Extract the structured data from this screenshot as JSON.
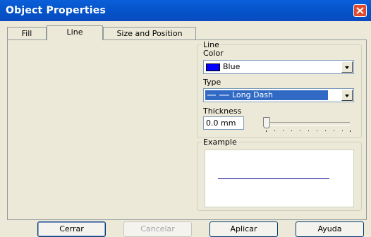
{
  "window": {
    "title": "Object Properties"
  },
  "tabs": [
    {
      "label": "Fill"
    },
    {
      "label": "Line",
      "active": true
    },
    {
      "label": "Size and Position"
    }
  ],
  "line_group": {
    "legend": "Line",
    "color_label": "Color",
    "color_value": "Blue",
    "color_swatch": "#0000ff",
    "type_label": "Type",
    "type_value": "Long Dash",
    "thickness_label": "Thickness",
    "thickness_value": "0.0 mm",
    "thickness_slider": 0
  },
  "example_group": {
    "legend": "Example",
    "line_color": "#00008b"
  },
  "buttons": {
    "close": "Cerrar",
    "cancel": "Cancelar",
    "apply": "Aplicar",
    "help": "Ayuda"
  },
  "colors": {
    "titlebar": "#0452c8",
    "selection": "#316ac5"
  }
}
